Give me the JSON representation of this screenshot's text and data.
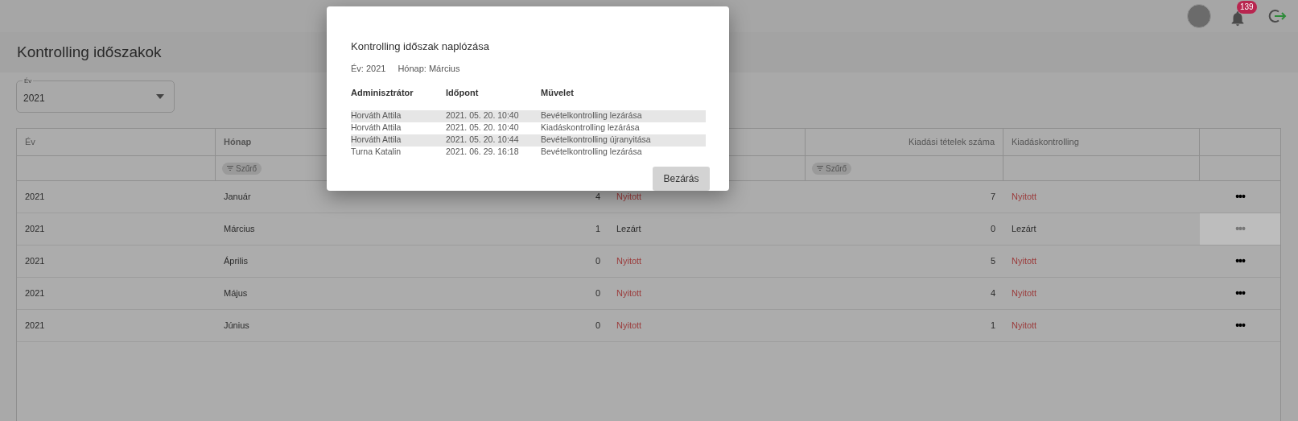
{
  "header": {
    "notification_count": "139"
  },
  "page": {
    "title": "Kontrolling időszakok"
  },
  "year_select": {
    "label": "Év",
    "value": "2021"
  },
  "table": {
    "columns": [
      {
        "label": "Év"
      },
      {
        "label": "Hónap",
        "filter": "Szűrő"
      },
      {},
      {},
      {
        "label": "Kiadási tételek száma",
        "filter": "Szűrő"
      },
      {
        "label": "Kiadáskontrolling"
      },
      {}
    ],
    "rows": [
      {
        "year": "2021",
        "month": "Január",
        "income_count": "4",
        "income_status": "Nyitott",
        "income_open": true,
        "expense_count": "7",
        "expense_status": "Nyitott",
        "expense_open": true,
        "actions": "•••",
        "selected": false
      },
      {
        "year": "2021",
        "month": "Március",
        "income_count": "1",
        "income_status": "Lezárt",
        "income_open": false,
        "expense_count": "0",
        "expense_status": "Lezárt",
        "expense_open": false,
        "actions": "•••",
        "selected": true
      },
      {
        "year": "2021",
        "month": "Április",
        "income_count": "0",
        "income_status": "Nyitott",
        "income_open": true,
        "expense_count": "5",
        "expense_status": "Nyitott",
        "expense_open": true,
        "actions": "•••",
        "selected": false
      },
      {
        "year": "2021",
        "month": "Május",
        "income_count": "0",
        "income_status": "Nyitott",
        "income_open": true,
        "expense_count": "4",
        "expense_status": "Nyitott",
        "expense_open": true,
        "actions": "•••",
        "selected": false
      },
      {
        "year": "2021",
        "month": "Június",
        "income_count": "0",
        "income_status": "Nyitott",
        "income_open": true,
        "expense_count": "1",
        "expense_status": "Nyitott",
        "expense_open": true,
        "actions": "•••",
        "selected": false
      }
    ]
  },
  "dialog": {
    "title": "Kontrolling időszak naplózása",
    "year": "Év: 2021",
    "month": "Hónap: Március",
    "columns": [
      "Adminisztrátor",
      "Időpont",
      "Müvelet"
    ],
    "rows": [
      [
        "Horváth Attila",
        "2021. 05. 20. 10:40",
        "Bevételkontrolling lezárása"
      ],
      [
        "Horváth Attila",
        "2021. 05. 20. 10:40",
        "Kiadáskontrolling lezárása"
      ],
      [
        "Horváth Attila",
        "2021. 05. 20. 10:44",
        "Bevételkontrolling újranyitása"
      ],
      [
        "Turna Katalin",
        "2021. 06. 29. 16:18",
        "Bevételkontrolling lezárása"
      ]
    ],
    "close_button": "Bezárás"
  }
}
